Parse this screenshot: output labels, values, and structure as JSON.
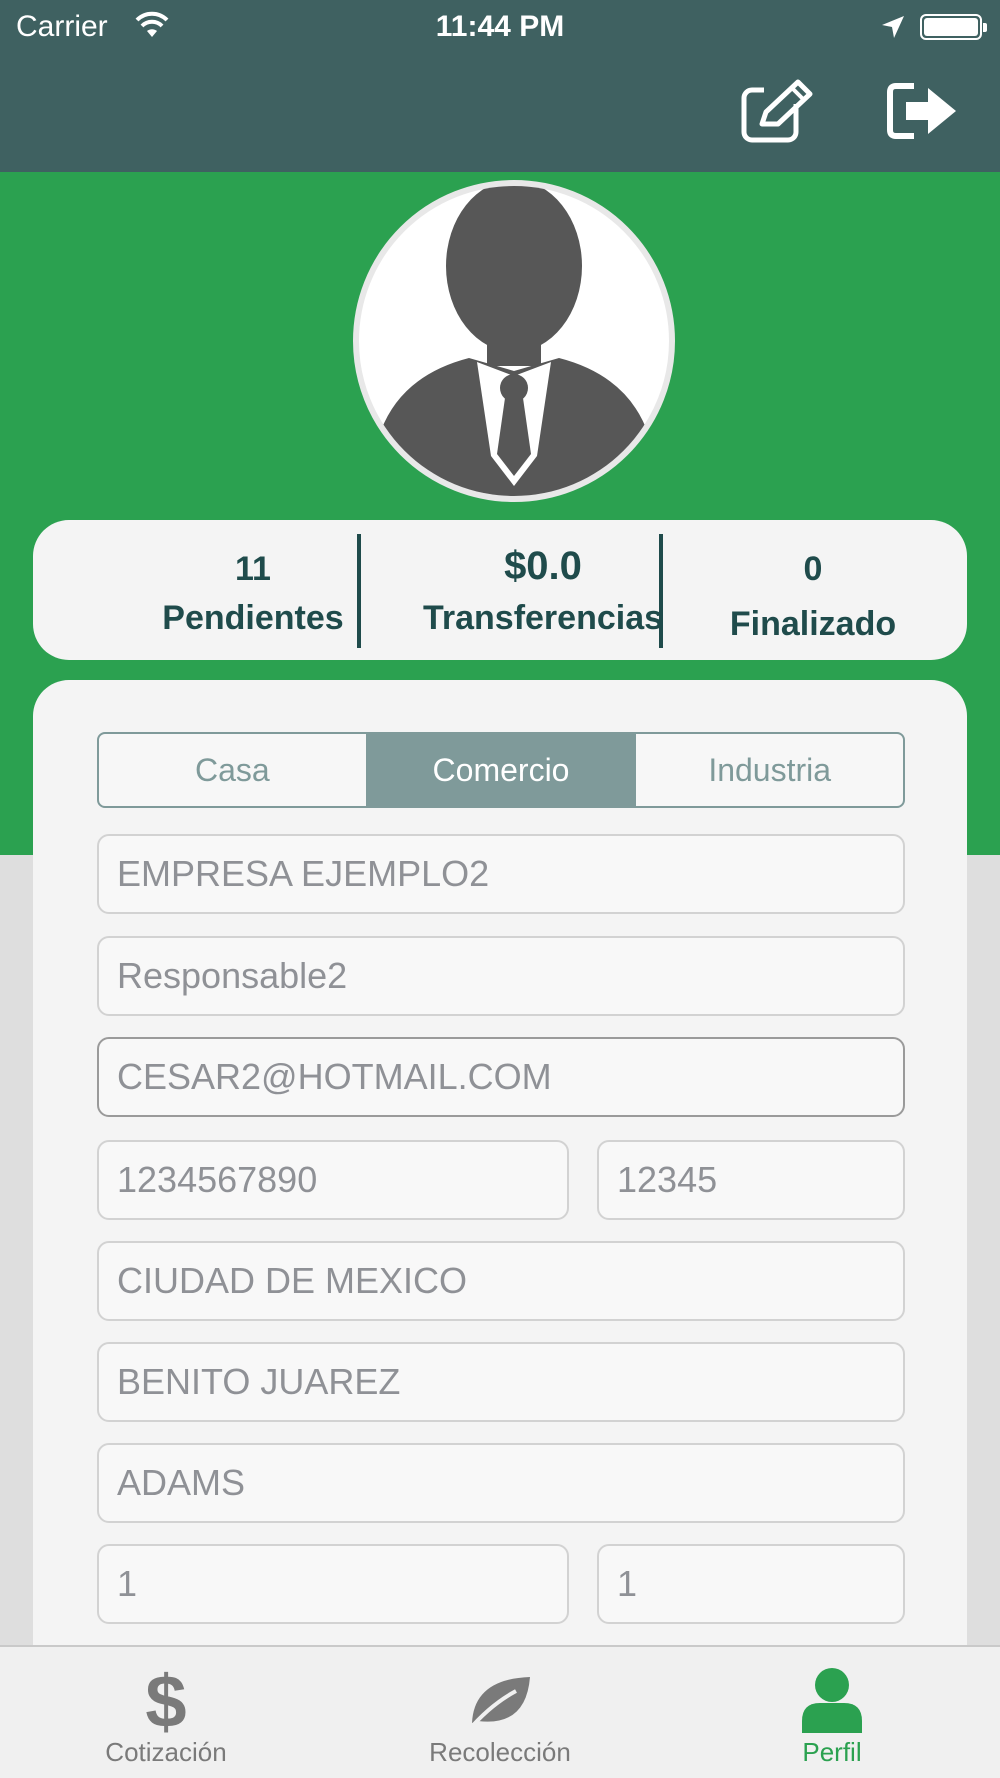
{
  "status_bar": {
    "carrier": "Carrier",
    "time": "11:44 PM"
  },
  "nav": {
    "edit_icon": "edit-icon",
    "logout_icon": "logout-icon"
  },
  "stats": [
    {
      "value": "11",
      "label": "Pendientes"
    },
    {
      "value": "$0.0",
      "label": "Transferencias"
    },
    {
      "value": "0",
      "label": "Finalizado"
    }
  ],
  "segments": {
    "items": [
      "Casa",
      "Comercio",
      "Industria"
    ],
    "selected": "Comercio"
  },
  "form": {
    "company": "EMPRESA EJEMPLO2",
    "responsible": "Responsable2",
    "email": "CESAR2@HOTMAIL.COM",
    "phone": "1234567890",
    "postal_code": "12345",
    "city": "CIUDAD DE MEXICO",
    "municipality": "BENITO JUAREZ",
    "street": "ADAMS",
    "ext_number": "1",
    "int_number": "1"
  },
  "tabbar": {
    "items": [
      {
        "label": "Cotización",
        "icon": "dollar-icon"
      },
      {
        "label": "Recolección",
        "icon": "leaf-icon"
      },
      {
        "label": "Perfil",
        "icon": "user-icon"
      }
    ],
    "active": "Perfil"
  },
  "colors": {
    "navbar": "#3f6161",
    "header_green": "#2ba150",
    "segment_active": "#7f9a9a",
    "stat_text": "#1f4b4b",
    "tab_active": "#2ba150"
  }
}
